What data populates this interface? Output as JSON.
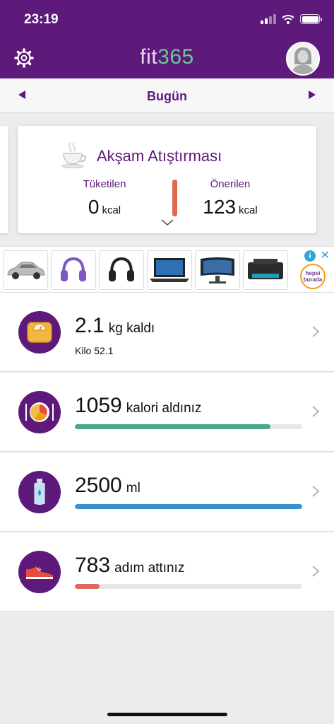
{
  "status": {
    "time": "23:19"
  },
  "header": {
    "logo_part1": "fit",
    "logo_part2": "365"
  },
  "day_nav": {
    "title": "Bugün"
  },
  "meal": {
    "title": "Akşam Atıştırması",
    "consumed_label": "Tüketilen",
    "consumed_value": "0",
    "consumed_unit": "kcal",
    "recommended_label": "Önerilen",
    "recommended_value": "123",
    "recommended_unit": "kcal"
  },
  "ad": {
    "info": "i",
    "close": "✕",
    "brand_line1": "hepsi",
    "brand_line2": "burada",
    "items": [
      "car",
      "purple-headphones",
      "black-headphones",
      "laptop",
      "monitor",
      "printer"
    ]
  },
  "rows": [
    {
      "value": "2.1",
      "label": "kg kaldı",
      "sub": "Kilo 52.1",
      "icon": "scale-icon"
    },
    {
      "value": "1059",
      "label": "kalori aldınız",
      "progress": 0.86,
      "color": "#4aa884",
      "icon": "plate-icon"
    },
    {
      "value": "2500",
      "label": "ml",
      "progress": 1.0,
      "color": "#3a8fd0",
      "icon": "water-bottle-icon"
    },
    {
      "value": "783",
      "label": "adım attınız",
      "progress": 0.11,
      "color": "#e06a5a",
      "icon": "sneaker-icon"
    }
  ],
  "colors": {
    "brand": "#5d1a7b",
    "accent_green": "#6fc59a"
  }
}
